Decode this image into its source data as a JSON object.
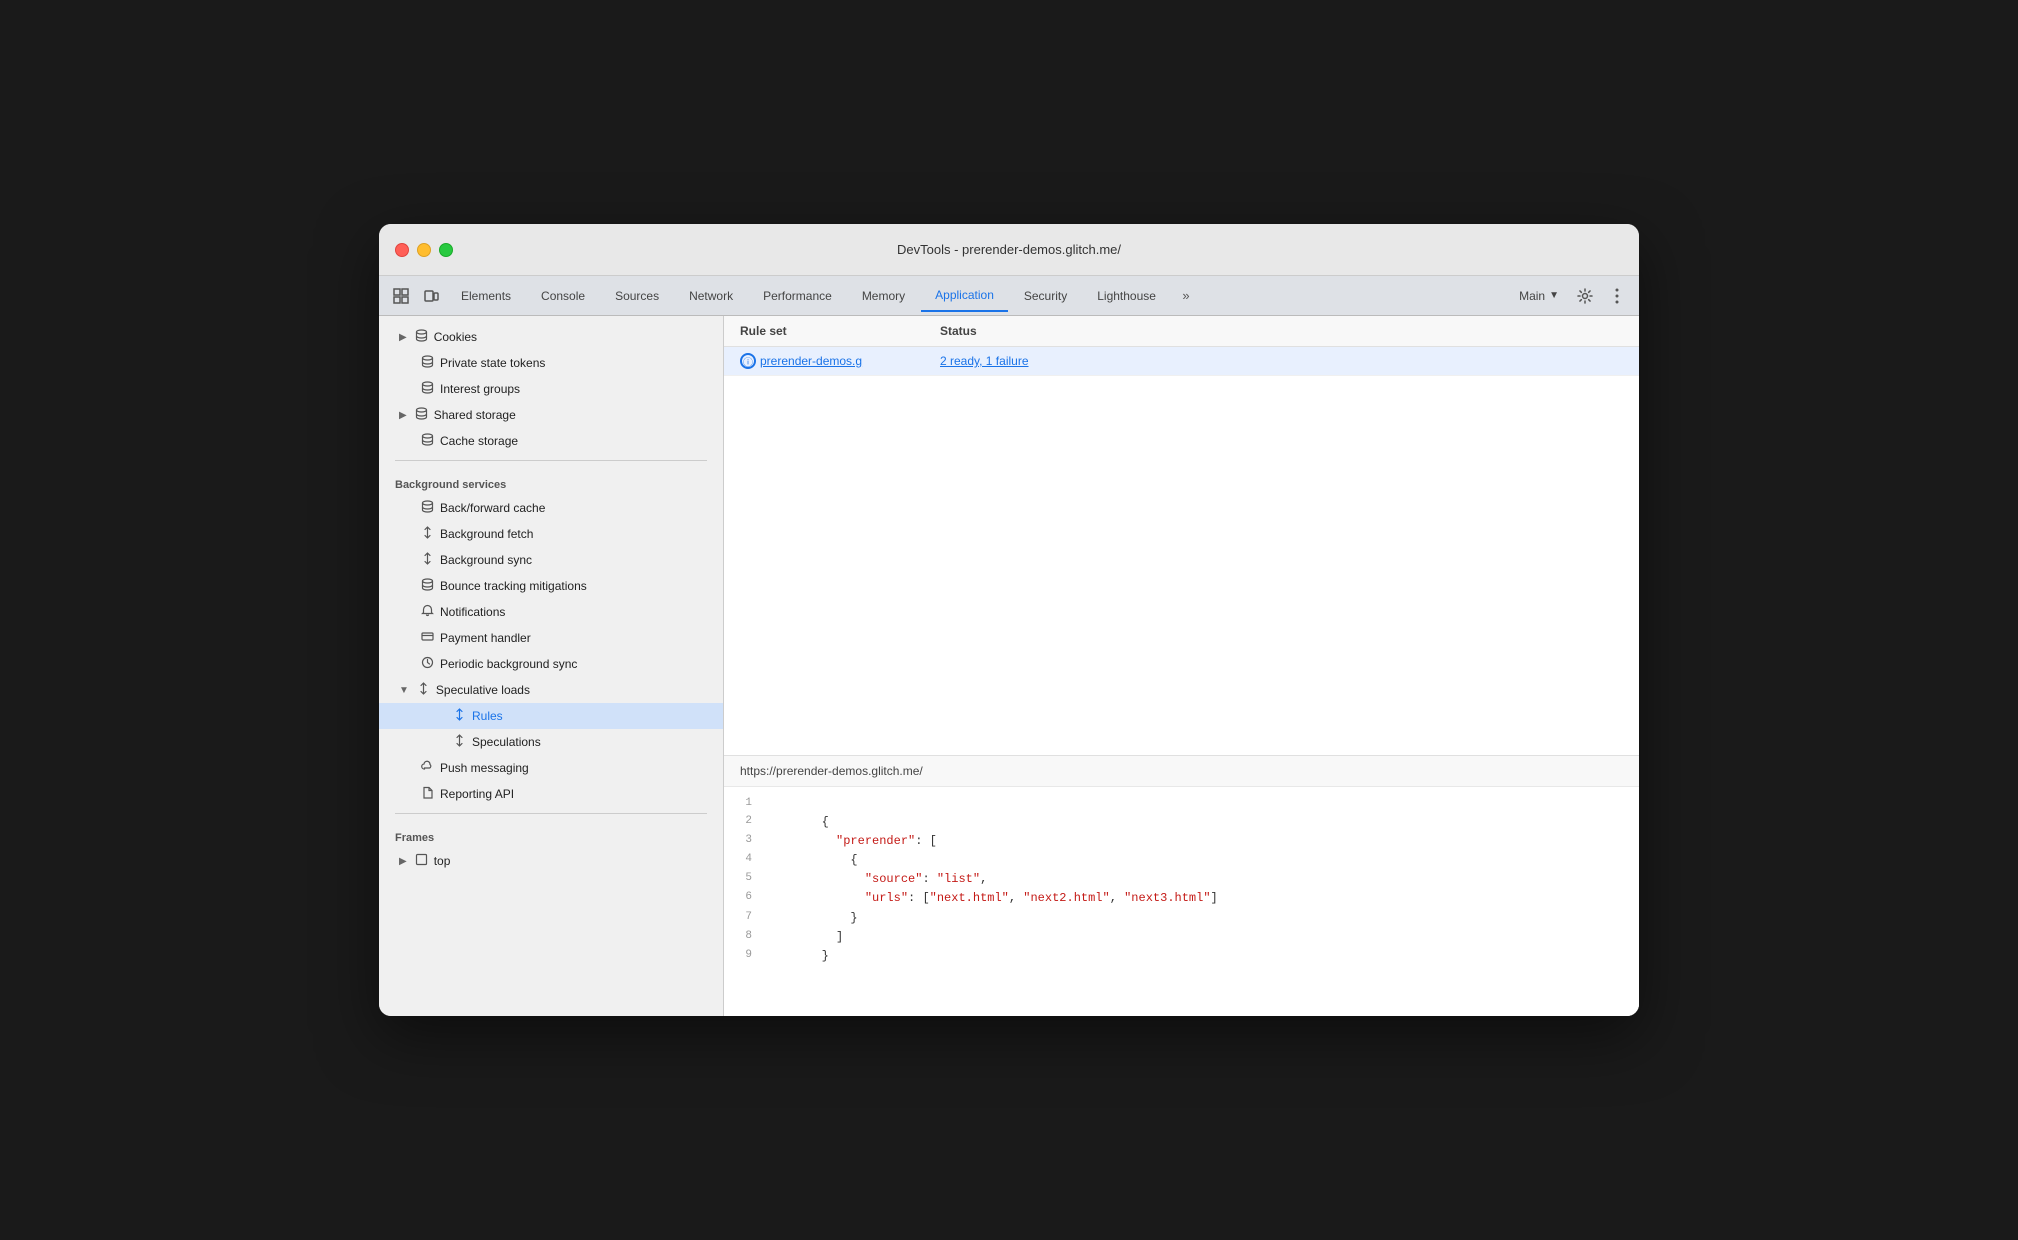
{
  "window": {
    "title": "DevTools - prerender-demos.glitch.me/"
  },
  "tabs": {
    "items": [
      {
        "label": "Elements",
        "active": false
      },
      {
        "label": "Console",
        "active": false
      },
      {
        "label": "Sources",
        "active": false
      },
      {
        "label": "Network",
        "active": false
      },
      {
        "label": "Performance",
        "active": false
      },
      {
        "label": "Memory",
        "active": false
      },
      {
        "label": "Application",
        "active": true
      },
      {
        "label": "Security",
        "active": false
      },
      {
        "label": "Lighthouse",
        "active": false
      }
    ],
    "overflow_label": ">>",
    "main_label": "Main",
    "settings_tooltip": "Settings",
    "more_tooltip": "More options"
  },
  "sidebar": {
    "sections": [
      {
        "name": "storage",
        "items": [
          {
            "label": "Cookies",
            "icon": "▶",
            "type": "expandable",
            "indent": 1
          },
          {
            "label": "Private state tokens",
            "icon": "🗄",
            "type": "leaf",
            "indent": 1
          },
          {
            "label": "Interest groups",
            "icon": "🗄",
            "type": "leaf",
            "indent": 1
          },
          {
            "label": "Shared storage",
            "icon": "▶",
            "expandIcon": "🗄",
            "type": "expandable",
            "indent": 1
          },
          {
            "label": "Cache storage",
            "icon": "🗄",
            "type": "leaf",
            "indent": 1
          }
        ]
      },
      {
        "name": "Background services",
        "label": "Background services",
        "items": [
          {
            "label": "Back/forward cache",
            "icon": "🗄",
            "type": "leaf",
            "indent": 1
          },
          {
            "label": "Background fetch",
            "icon": "↕",
            "type": "leaf",
            "indent": 1
          },
          {
            "label": "Background sync",
            "icon": "↕",
            "type": "leaf",
            "indent": 1
          },
          {
            "label": "Bounce tracking mitigations",
            "icon": "🗄",
            "type": "leaf",
            "indent": 1
          },
          {
            "label": "Notifications",
            "icon": "🔔",
            "type": "leaf",
            "indent": 1
          },
          {
            "label": "Payment handler",
            "icon": "💳",
            "type": "leaf",
            "indent": 1
          },
          {
            "label": "Periodic background sync",
            "icon": "🕐",
            "type": "leaf",
            "indent": 1
          },
          {
            "label": "Speculative loads",
            "icon": "▼",
            "type": "expanded",
            "indent": 1,
            "active": false,
            "children": [
              {
                "label": "Rules",
                "icon": "↕",
                "type": "leaf",
                "indent": 2,
                "active": true
              },
              {
                "label": "Speculations",
                "icon": "↕",
                "type": "leaf",
                "indent": 2,
                "active": false
              }
            ]
          },
          {
            "label": "Push messaging",
            "icon": "☁",
            "type": "leaf",
            "indent": 1
          },
          {
            "label": "Reporting API",
            "icon": "📄",
            "type": "leaf",
            "indent": 1
          }
        ]
      },
      {
        "name": "Frames",
        "label": "Frames",
        "items": [
          {
            "label": "top",
            "icon": "▶",
            "frameIcon": "⬜",
            "type": "expandable",
            "indent": 1
          }
        ]
      }
    ]
  },
  "table": {
    "headers": [
      {
        "label": "Rule set",
        "key": "rule_set"
      },
      {
        "label": "Status",
        "key": "status"
      }
    ],
    "rows": [
      {
        "rule_set": "prerender-demos.g",
        "status": "2 ready, 1 failure",
        "url": "prerender-demos.g"
      }
    ]
  },
  "bottom_panel": {
    "url": "https://prerender-demos.glitch.me/",
    "code_lines": [
      {
        "num": 1,
        "content": ""
      },
      {
        "num": 2,
        "content": "        {"
      },
      {
        "num": 3,
        "content": "          \"prerender\": ["
      },
      {
        "num": 4,
        "content": "            {"
      },
      {
        "num": 5,
        "content": "              \"source\": \"list\","
      },
      {
        "num": 6,
        "content": "              \"urls\": [\"next.html\", \"next2.html\", \"next3.html\"]"
      },
      {
        "num": 7,
        "content": "            }"
      },
      {
        "num": 8,
        "content": "          ]"
      },
      {
        "num": 9,
        "content": "        }"
      }
    ]
  },
  "icons": {
    "inspect": "⬚",
    "device": "⬒",
    "chevron_right": "▶",
    "chevron_down": "▼",
    "database": "🗄",
    "sync": "↕",
    "bell": "🔔",
    "card": "💳",
    "clock": "⏱",
    "cloud": "☁",
    "page": "📄",
    "frame": "⬜",
    "circle_info": "ⓘ",
    "gear": "⚙",
    "dots": "⋮",
    "more_chevron": "»"
  }
}
